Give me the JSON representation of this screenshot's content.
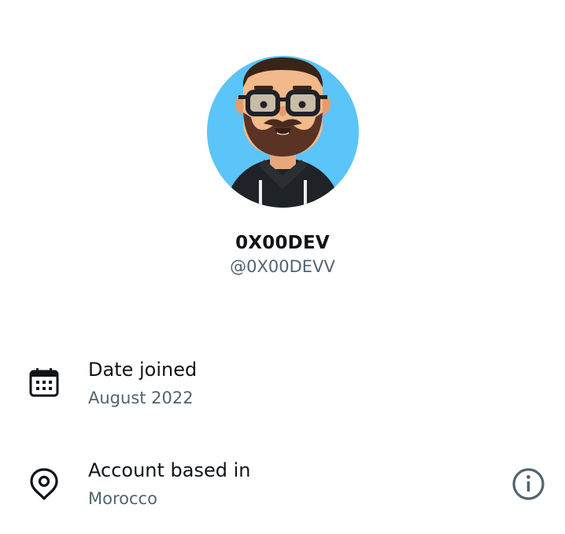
{
  "profile": {
    "display_name": "0X00DEV",
    "handle": "@0X00DEVV",
    "avatar_icon": "cartoon-man-glasses-beard-avatar"
  },
  "details": {
    "date_joined": {
      "label": "Date joined",
      "value": "August 2022",
      "icon": "calendar-icon"
    },
    "account_based": {
      "label": "Account based in",
      "value": "Morocco",
      "icon": "location-pin-icon",
      "info_icon": "info-icon"
    }
  },
  "colors": {
    "text_primary": "#0f1419",
    "text_secondary": "#536471",
    "avatar_background": "#5bc4f8",
    "icon_gray": "#536471"
  }
}
